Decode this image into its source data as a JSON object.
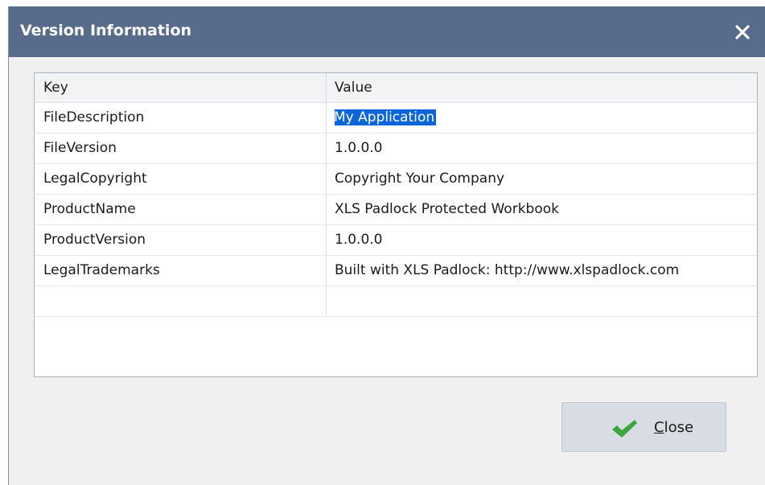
{
  "window": {
    "title": "Version Information",
    "close_icon": "close-x-icon"
  },
  "table": {
    "columns": [
      "Key",
      "Value"
    ],
    "rows": [
      {
        "key": "FileDescription",
        "value": "My Application",
        "selected": true
      },
      {
        "key": "FileVersion",
        "value": "1.0.0.0"
      },
      {
        "key": "LegalCopyright",
        "value": "Copyright Your Company"
      },
      {
        "key": "ProductName",
        "value": "XLS Padlock Protected Workbook"
      },
      {
        "key": "ProductVersion",
        "value": "1.0.0.0"
      },
      {
        "key": "LegalTrademarks",
        "value": "Built with XLS Padlock: http://www.xlspadlock.com"
      }
    ]
  },
  "button": {
    "mnemonic": "C",
    "rest": "lose",
    "icon": "checkmark-icon"
  },
  "colors": {
    "titlebar": "#576b8a",
    "selection": "#0a66d8",
    "check": "#3aa63e"
  }
}
